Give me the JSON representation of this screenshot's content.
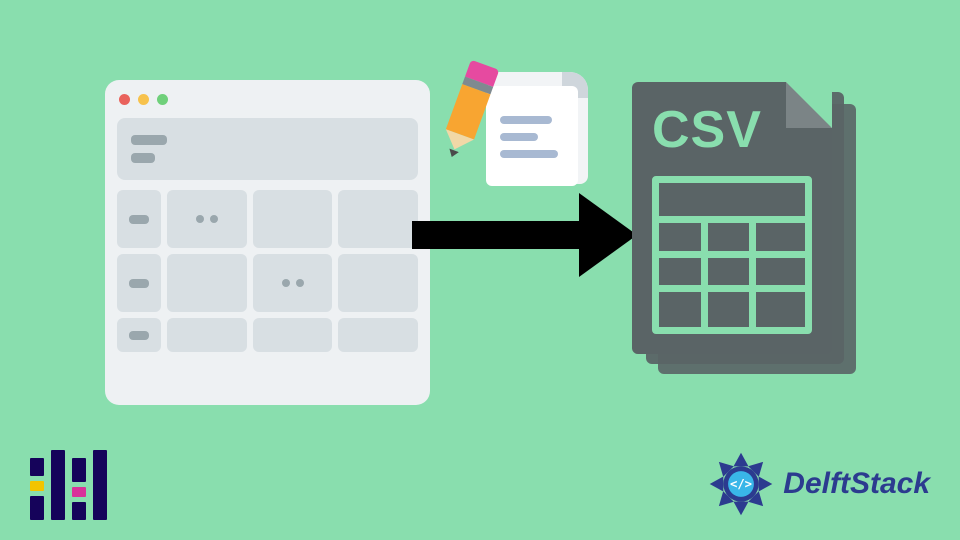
{
  "csv": {
    "label": "CSV"
  },
  "brand": {
    "name": "DelftStack"
  },
  "icons": {
    "spreadsheet": "spreadsheet-window-icon",
    "arrow": "arrow-right-icon",
    "notepad": "notepad-pencil-icon",
    "csv": "csv-file-stack-icon",
    "pandas": "pandas-logo-icon",
    "delft": "delftstack-logo-icon"
  }
}
